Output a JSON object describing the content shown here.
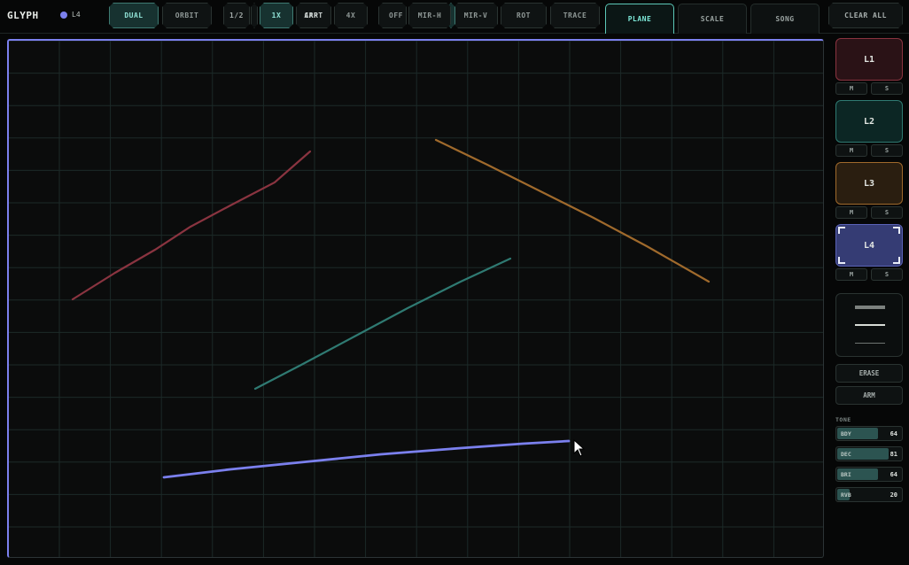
{
  "app": {
    "title": "GLYPH",
    "active_layer": "L4",
    "active_layer_color": "#7b80ee"
  },
  "toolbar": {
    "mode_buttons": [
      {
        "label": "DUAL",
        "active": true
      },
      {
        "label": "ORBIT",
        "active": false
      }
    ],
    "speed_buttons": [
      {
        "label": "1/2",
        "active": false
      },
      {
        "label": "1X",
        "active": true
      },
      {
        "label": "4X",
        "active": false
      }
    ],
    "overlapping_labels": {
      "arp": "ARP",
      "cart": "CART",
      "off": "OFF",
      "o_prefix": "O"
    },
    "transform_buttons": [
      {
        "label": "MIR-H"
      },
      {
        "label": "MIR-V"
      },
      {
        "label": "ROT"
      },
      {
        "label": "TRACE"
      }
    ]
  },
  "tabs": [
    {
      "label": "PLANE",
      "active": true
    },
    {
      "label": "SCALE",
      "active": false
    },
    {
      "label": "SONG",
      "active": false
    }
  ],
  "clear_all_label": "CLEAR ALL",
  "layers": [
    {
      "label": "L1",
      "color": "#8a3440",
      "bg": "#2a1216",
      "mute": "M",
      "solo": "S"
    },
    {
      "label": "L2",
      "color": "#2f7a72",
      "bg": "#0c2624",
      "mute": "M",
      "solo": "S"
    },
    {
      "label": "L3",
      "color": "#a06a2c",
      "bg": "#2a1e10",
      "mute": "M",
      "solo": "S"
    },
    {
      "label": "L4",
      "color": "#7b80ee",
      "bg": "#353c74",
      "mute": "M",
      "solo": "S",
      "selected": true
    }
  ],
  "brush_widths": [
    "thick",
    "medium",
    "thin"
  ],
  "erase_label": "ERASE",
  "arm_label": "ARM",
  "tone": {
    "label": "TONE",
    "params": [
      {
        "name": "BDY",
        "value": 64
      },
      {
        "name": "DEC",
        "value": 81
      },
      {
        "name": "BRI",
        "value": 64
      },
      {
        "name": "RVB",
        "value": 20
      }
    ]
  },
  "strokes": [
    {
      "layer": "L1",
      "color": "#8a3440"
    },
    {
      "layer": "L2",
      "color": "#2f7a72"
    },
    {
      "layer": "L3",
      "color": "#a06a2c"
    },
    {
      "layer": "L4",
      "color": "#7b80ee"
    }
  ]
}
